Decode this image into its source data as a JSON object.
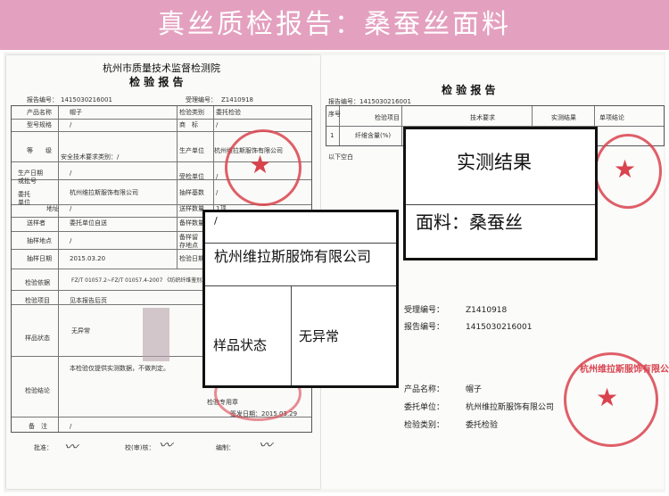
{
  "banner": {
    "title": "真丝质检报告：桑蚕丝面料"
  },
  "left_report": {
    "institute": "杭州市质量技术监督检测院",
    "title": "检 验 报 告",
    "report_no_label": "报告编号：",
    "report_no": "1415030216001",
    "accept_no_label": "受理编号：",
    "accept_no": "Z1410918",
    "rows": [
      {
        "label": "产品名称",
        "value": "帽子",
        "label2": "检验类别",
        "value2": "委托检验"
      },
      {
        "label": "型号规格",
        "value": "/",
        "label2": "商　标",
        "value2": "/"
      },
      {
        "label": "等　　级",
        "value": "安全技术要求类别：/",
        "label2": "生产单位",
        "value2": "杭州维拉斯服饰有限公司"
      },
      {
        "label": "生产日期或批号",
        "value": "/",
        "label2": "受检单位",
        "value2": "/"
      },
      {
        "label": "委托单位",
        "value": "杭州维拉斯服饰有限公司",
        "label2": "抽样基数",
        "value2": "/"
      },
      {
        "label": "地址",
        "value": "/",
        "label2": "送样数量",
        "value2": "1顶"
      },
      {
        "label": "送样者",
        "value": "委托单位自送",
        "label2": "备样数量",
        "value2": ""
      },
      {
        "label": "抽样地点",
        "value": "/",
        "label2": "备样留存地点",
        "value2": ""
      },
      {
        "label": "抽样日期",
        "value": "2015.03.20",
        "label2": "检验日期",
        "value2": ""
      }
    ],
    "basis_label": "检验依据",
    "basis_value": "FZ/T 01057.2~FZ/T 01057.4-2007 《纺织纤维鉴别》",
    "items_label": "检验项目",
    "items_value": "见本报告后页",
    "condition_label": "样品状态",
    "condition_value": "无异常",
    "conclusion_label": "检验结论",
    "conclusion_value": "本检验仅提供实测数据，不做判定。",
    "stamp_label": "检验专用章",
    "issue_date": "签发日期：2015.03.29",
    "remark_label": "备　注",
    "remark_value": "/",
    "approve_label": "批准：",
    "review_label": "校(审)核：",
    "compile_label": "编制："
  },
  "right_report": {
    "title": "检 验 报 告",
    "report_no": "报告编号：1415030216001",
    "cols": [
      "序号",
      "检验项目",
      "技术要求",
      "实测结果",
      "单项结论"
    ],
    "row_no": "1",
    "row_item": "纤维含量(%)",
    "below_blank": "以下空白",
    "accept_label": "受理编号：",
    "accept_value": "Z1410918",
    "report_label": "报告编号：",
    "report_value": "1415030216001",
    "product_label": "产品名称：",
    "product_value": "帽子",
    "client_label": "委托单位：",
    "client_value": "杭州维拉斯服饰有限公司",
    "category_label": "检验类别：",
    "category_value": "委托检验"
  },
  "callouts": {
    "result_heading": "实测结果",
    "fabric_label": "面料：桑蚕丝",
    "company_slash": "/",
    "company": "杭州维拉斯服饰有限公司",
    "status_label": "样品状态",
    "status_value": "无异常"
  },
  "seals": {
    "company_seal_text": "杭州维拉斯服饰有限公司"
  },
  "colors": {
    "banner": "#e4a0bf",
    "seal": "#d9434e"
  }
}
